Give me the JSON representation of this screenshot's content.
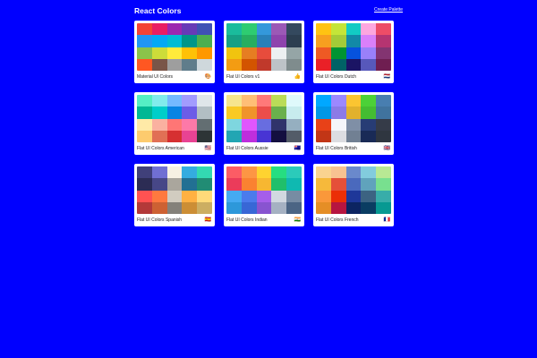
{
  "header": {
    "title": "React Colors",
    "create_link": "Create Palette"
  },
  "palettes": [
    {
      "name": "Material UI Colors",
      "emoji": "🎨",
      "colors": [
        "#f44336",
        "#e91e63",
        "#9c27b0",
        "#673ab7",
        "#3f51b5",
        "#2196f3",
        "#03a9f4",
        "#00bcd4",
        "#009688",
        "#4caf50",
        "#8bc34a",
        "#cddc39",
        "#ffeb3b",
        "#ffc107",
        "#ff9800",
        "#ff5722",
        "#795548",
        "#9e9e9e",
        "#607d8b",
        "#cfd8dc"
      ]
    },
    {
      "name": "Flat UI Colors v1",
      "emoji": "👍",
      "colors": [
        "#1abc9c",
        "#2ecc71",
        "#3498db",
        "#9b59b6",
        "#34495e",
        "#16a085",
        "#27ae60",
        "#2980b9",
        "#8e44ad",
        "#2c3e50",
        "#f1c40f",
        "#e67e22",
        "#e74c3c",
        "#ecf0f1",
        "#95a5a6",
        "#f39c12",
        "#d35400",
        "#c0392b",
        "#bdc3c7",
        "#7f8c8d"
      ]
    },
    {
      "name": "Flat UI Colors Dutch",
      "emoji": "🇳🇱",
      "colors": [
        "#ffc312",
        "#c4e538",
        "#12cbc4",
        "#fda7df",
        "#ed4c67",
        "#f79f1f",
        "#a3cb38",
        "#1289a7",
        "#d980fa",
        "#b53471",
        "#ee5a24",
        "#009432",
        "#0652dd",
        "#9980fa",
        "#833471",
        "#ea2027",
        "#006266",
        "#1b1464",
        "#5758bb",
        "#6f1e51"
      ]
    },
    {
      "name": "Flat UI Colors American",
      "emoji": "🇺🇸",
      "colors": [
        "#55efc4",
        "#81ecec",
        "#74b9ff",
        "#a29bfe",
        "#dfe6e9",
        "#00b894",
        "#00cec9",
        "#0984e3",
        "#6c5ce7",
        "#b2bec3",
        "#ffeaa7",
        "#fab1a0",
        "#ff7675",
        "#fd79a8",
        "#636e72",
        "#fdcb6e",
        "#e17055",
        "#d63031",
        "#e84393",
        "#2d3436"
      ]
    },
    {
      "name": "Flat UI Colors Aussie",
      "emoji": "🇦🇺",
      "colors": [
        "#f6e58d",
        "#ffbe76",
        "#ff7979",
        "#badc58",
        "#dff9fb",
        "#f9ca24",
        "#f0932b",
        "#eb4d4b",
        "#6ab04c",
        "#c7ecee",
        "#7ed6df",
        "#e056fd",
        "#686de0",
        "#30336b",
        "#95afc0",
        "#22a6b3",
        "#be2edd",
        "#4834d4",
        "#130f40",
        "#535c68"
      ]
    },
    {
      "name": "Flat UI Colors British",
      "emoji": "🇬🇧",
      "colors": [
        "#00a8ff",
        "#9c88ff",
        "#fbc531",
        "#4cd137",
        "#487eb0",
        "#0097e6",
        "#8c7ae6",
        "#e1b12c",
        "#44bd32",
        "#40739e",
        "#e84118",
        "#f5f6fa",
        "#7f8fa6",
        "#273c75",
        "#353b48",
        "#c23616",
        "#dcdde1",
        "#718093",
        "#192a56",
        "#2f3640"
      ]
    },
    {
      "name": "Flat UI Colors Spanish",
      "emoji": "🇪🇸",
      "colors": [
        "#40407a",
        "#706fd3",
        "#f7f1e3",
        "#34ace0",
        "#33d9b2",
        "#2c2c54",
        "#474787",
        "#aaa69d",
        "#227093",
        "#218c74",
        "#ff5252",
        "#ff793f",
        "#d1ccc0",
        "#ffb142",
        "#ffda79",
        "#b33939",
        "#cd6133",
        "#84817a",
        "#cc8e35",
        "#ccae62"
      ]
    },
    {
      "name": "Flat UI Colors Indian",
      "emoji": "🇮🇳",
      "colors": [
        "#fc5c65",
        "#fd9644",
        "#fed330",
        "#26de81",
        "#2bcbba",
        "#eb3b5a",
        "#fa8231",
        "#f7b731",
        "#20bf6b",
        "#0fb9b1",
        "#45aaf2",
        "#4b7bec",
        "#a55eea",
        "#d1d8e0",
        "#778ca3",
        "#2d98da",
        "#3867d6",
        "#8854d0",
        "#a5b1c2",
        "#4b6584"
      ]
    },
    {
      "name": "Flat UI Colors French",
      "emoji": "🇫🇷",
      "colors": [
        "#fad390",
        "#f8c291",
        "#6a89cc",
        "#82ccdd",
        "#b8e994",
        "#f6b93b",
        "#e55039",
        "#4a69bd",
        "#60a3bc",
        "#78e08f",
        "#fa983a",
        "#eb2f06",
        "#1e3799",
        "#3c6382",
        "#38ada9",
        "#e58e26",
        "#b71540",
        "#0c2461",
        "#0a3d62",
        "#079992"
      ]
    }
  ]
}
